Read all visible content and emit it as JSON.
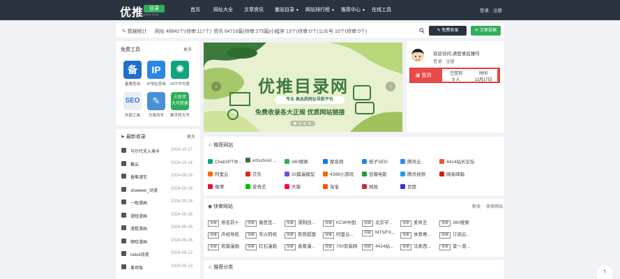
{
  "header": {
    "logo_text": "优推",
    "logo_badge": "目录",
    "logo_sub": "ytmu.com",
    "nav": [
      {
        "label": "首页",
        "dropdown": false
      },
      {
        "label": "网址大全",
        "dropdown": false
      },
      {
        "label": "文章资讯",
        "dropdown": false
      },
      {
        "label": "搬站目录",
        "dropdown": true
      },
      {
        "label": "网站排行榜",
        "dropdown": true
      },
      {
        "label": "推荐中心",
        "dropdown": true
      },
      {
        "label": "在线工具",
        "dropdown": false
      }
    ],
    "login": "登录",
    "register": "注册"
  },
  "stats": {
    "title": "数据统计",
    "websites": "网址 48842个(待审:117个)",
    "articles": "资讯 64716篇(待审:275篇)",
    "apps": "小程序 13个(待审:0个)",
    "official": "公众号 10个(待审:0个)",
    "submit_label": "免费收录",
    "post_label": "文章投稿"
  },
  "tools": {
    "title": "免费工具",
    "more": "更多",
    "items": [
      {
        "label": "备案查询",
        "icon": "beian-icon",
        "color": "#1f6fd1"
      },
      {
        "label": "IP地址查询",
        "icon": "ip-icon",
        "color": "#2b86e6"
      },
      {
        "label": "GPT中文版",
        "icon": "gpt-icon",
        "color": "#0fa37f"
      },
      {
        "label": "外链工具",
        "icon": "seo-icon",
        "color": "#3a7bd5"
      },
      {
        "label": "文章改写",
        "icon": "rewrite-icon",
        "color": "#4a90d9"
      },
      {
        "label": "数字转大写",
        "icon": "rmb-icon",
        "color": "#2fae5a"
      }
    ]
  },
  "news": {
    "title": "最新收录",
    "more": "更多",
    "items": [
      {
        "title": "马尔代夫入境卡",
        "date": "2024-10-17"
      },
      {
        "title": "聚云",
        "date": "2024-10-14"
      },
      {
        "title": "香蕉漫宅",
        "date": "2024-09-26"
      },
      {
        "title": "shwewer_动漫",
        "date": "2024-09-26"
      },
      {
        "title": "一耽漫画",
        "date": "2024-09-26"
      },
      {
        "title": "漫蛙漫画",
        "date": "2024-09-26"
      },
      {
        "title": "漫狐漫画",
        "date": "2024-09-26"
      },
      {
        "title": "啊哈漫画",
        "date": "2024-09-26"
      },
      {
        "title": "nekoi动漫",
        "date": "2024-09-12"
      },
      {
        "title": "果场兔",
        "date": "2024-09-13"
      }
    ]
  },
  "banner": {
    "title": "优推目录网",
    "sub": "专业 高品质网址导航平台",
    "slogan": "免费收录各大正规 优质网站链接"
  },
  "user": {
    "welcome": "欢迎访问,请登录后操作",
    "login": "登录",
    "register": "注册",
    "signin": "签到",
    "signed_label": "已签到",
    "signed_value": "9 人",
    "time_label": "时间",
    "time_value": "11月17日"
  },
  "recommend": {
    "title": "推荐网站",
    "items": [
      {
        "label": "ChatGPT中...",
        "color": "#10a37f"
      },
      {
        "label": "w3school ...",
        "color": "#3c6e3c"
      },
      {
        "label": "360搜索",
        "color": "#2fae5a"
      },
      {
        "label": "聚名网",
        "color": "#1a73e8"
      },
      {
        "label": "桔子SEO",
        "color": "#1e88e5"
      },
      {
        "label": "腾讯云",
        "color": "#2b8cee"
      },
      {
        "label": "4414站长论坛",
        "color": "#e35b2e"
      },
      {
        "label": "阿里云",
        "color": "#ff6a00"
      },
      {
        "label": "京东",
        "color": "#e1251b"
      },
      {
        "label": "30篇漏模型",
        "color": "#6b4ee6"
      },
      {
        "label": "4399小游戏",
        "color": "#ef6c00"
      },
      {
        "label": "豆瓣电影",
        "color": "#2e963d"
      },
      {
        "label": "腾讯视频",
        "color": "#19a0f0"
      },
      {
        "label": "网易邮箱",
        "color": "#d81e06"
      },
      {
        "label": "微博",
        "color": "#e6162d"
      },
      {
        "label": "爱奇艺",
        "color": "#00be06"
      },
      {
        "label": "天猫",
        "color": "#ff0036"
      },
      {
        "label": "淘宝",
        "color": "#ff5000"
      },
      {
        "label": "网易",
        "color": "#c9302c"
      },
      {
        "label": "百度",
        "color": "#2932e1"
      }
    ]
  },
  "fast": {
    "title": "快审网站",
    "tab1": "新收",
    "tab2": "快审网站",
    "tag": "快审",
    "items": [
      "排名前十",
      "蜀思签...",
      "漂购回...",
      "KCW中国",
      "北京学...",
      "爱奇艺",
      "360搜索",
      "声视导航",
      "朱兴莉视",
      "熊熊狐狸",
      "阿里云...",
      "MT5/FX...",
      "体育赛...",
      "订阅云...",
      "熊猫漫画",
      "红石漫画",
      "香蕉漫...",
      "700安装网",
      "4414站...",
      "马来西...",
      "爱一游..."
    ]
  },
  "category": {
    "title": "推荐分类"
  }
}
